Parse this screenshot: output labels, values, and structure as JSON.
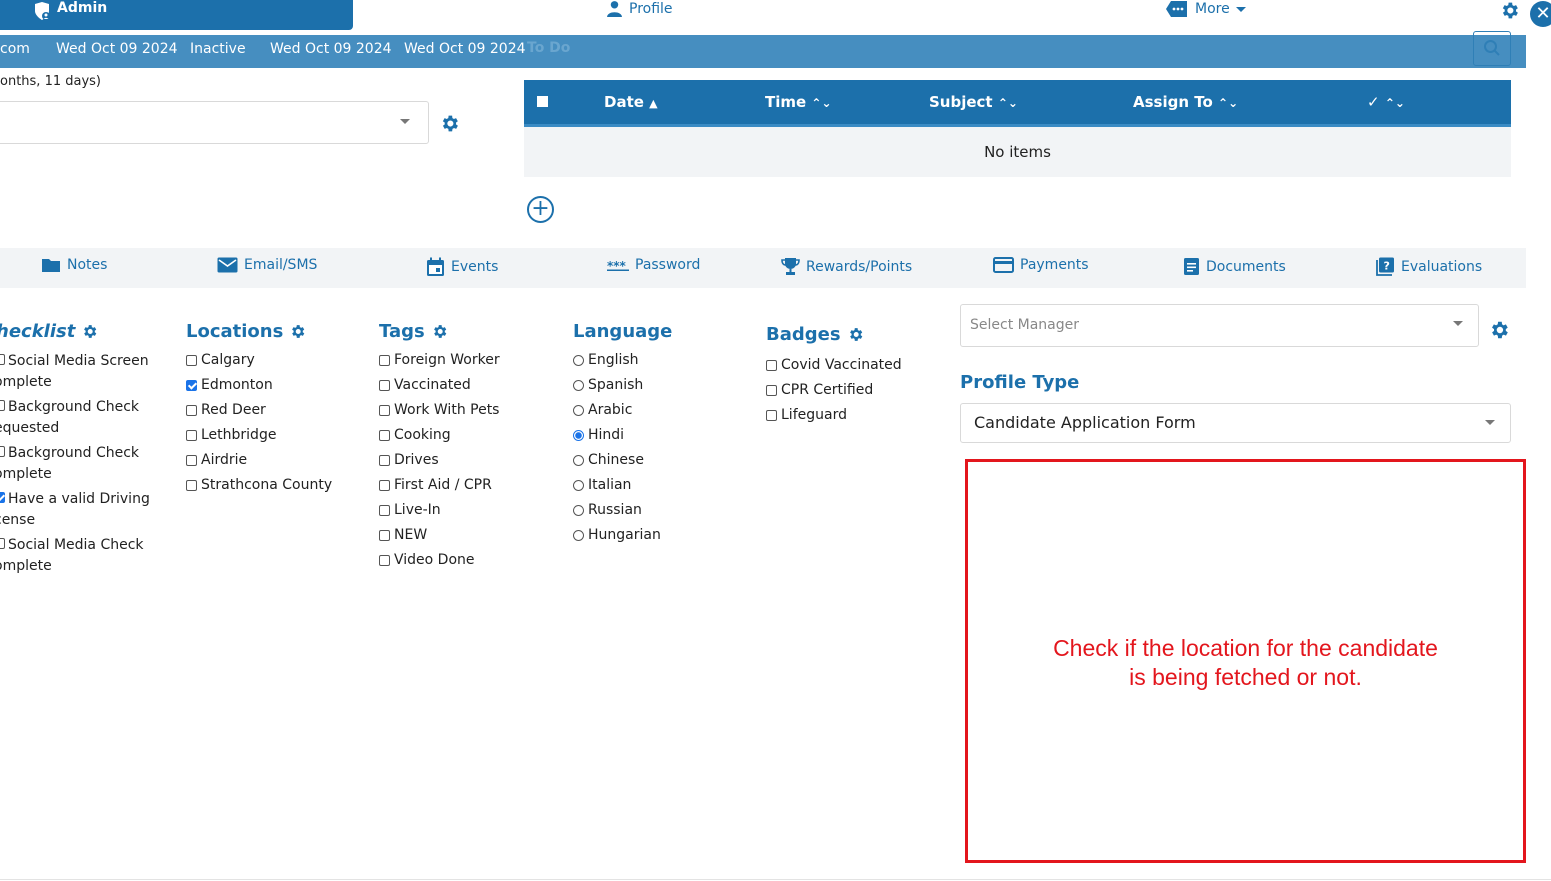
{
  "topbar": {
    "admin_label": "Admin",
    "profile_label": "Profile",
    "more_label": "More",
    "close_glyph": "✕"
  },
  "info_strip": {
    "email_tail": "com",
    "date1": "Wed Oct 09 2024",
    "status": "Inactive",
    "date2": "Wed Oct 09 2024",
    "date3": "Wed Oct 09 2024",
    "todo_title": "To Do"
  },
  "left_form": {
    "duration_text": "onths, 11 days)"
  },
  "todo_table": {
    "columns": [
      "Date",
      "Time",
      "Subject",
      "Assign To",
      "✓"
    ],
    "empty_text": "No items",
    "add_glyph": "+"
  },
  "tabs": [
    {
      "label": "Notes",
      "icon": "folder-icon"
    },
    {
      "label": "Email/SMS",
      "icon": "envelope-icon"
    },
    {
      "label": "Events",
      "icon": "calendar-icon"
    },
    {
      "label": "Password",
      "icon": "password-icon"
    },
    {
      "label": "Rewards/Points",
      "icon": "trophy-icon"
    },
    {
      "label": "Payments",
      "icon": "credit-card-icon"
    },
    {
      "label": "Documents",
      "icon": "document-icon"
    },
    {
      "label": "Evaluations",
      "icon": "evaluation-icon"
    }
  ],
  "checklist": {
    "title": "hecklist",
    "items": [
      {
        "line1": "Social Media Screen",
        "line2": "omplete",
        "checked": false
      },
      {
        "line1": "Background Check",
        "line2": "equested",
        "checked": false
      },
      {
        "line1": "Background Check",
        "line2": "omplete",
        "checked": false
      },
      {
        "line1": "Have a valid Driving",
        "line2": "cense",
        "checked": true
      },
      {
        "line1": "Social Media Check",
        "line2": "omplete",
        "checked": false
      }
    ]
  },
  "locations": {
    "title": "Locations",
    "items": [
      {
        "label": "Calgary",
        "checked": false
      },
      {
        "label": "Edmonton",
        "checked": true
      },
      {
        "label": "Red Deer",
        "checked": false
      },
      {
        "label": "Lethbridge",
        "checked": false
      },
      {
        "label": "Airdrie",
        "checked": false
      },
      {
        "label": "Strathcona County",
        "checked": false
      }
    ]
  },
  "tags": {
    "title": "Tags",
    "items": [
      {
        "label": "Foreign Worker",
        "checked": false
      },
      {
        "label": "Vaccinated",
        "checked": false
      },
      {
        "label": "Work With Pets",
        "checked": false
      },
      {
        "label": "Cooking",
        "checked": false
      },
      {
        "label": "Drives",
        "checked": false
      },
      {
        "label": "First Aid / CPR",
        "checked": false
      },
      {
        "label": "Live-In",
        "checked": false
      },
      {
        "label": "NEW",
        "checked": false
      },
      {
        "label": "Video Done",
        "checked": false
      }
    ]
  },
  "language": {
    "title": "Language",
    "items": [
      {
        "label": "English",
        "selected": false
      },
      {
        "label": "Spanish",
        "selected": false
      },
      {
        "label": "Arabic",
        "selected": false
      },
      {
        "label": "Hindi",
        "selected": true
      },
      {
        "label": "Chinese",
        "selected": false
      },
      {
        "label": "Italian",
        "selected": false
      },
      {
        "label": "Russian",
        "selected": false
      },
      {
        "label": "Hungarian",
        "selected": false
      }
    ]
  },
  "badges": {
    "title": "Badges",
    "items": [
      {
        "label": "Covid Vaccinated",
        "checked": false
      },
      {
        "label": "CPR Certified",
        "checked": false
      },
      {
        "label": "Lifeguard",
        "checked": false
      }
    ]
  },
  "manager": {
    "placeholder": "Select Manager"
  },
  "profile_type": {
    "title": "Profile Type",
    "value": "Candidate Application Form"
  },
  "annotation": {
    "line1": "Check if the location for the candidate",
    "line2": "is being fetched or not.",
    "color": "#e3161d"
  },
  "colors": {
    "brand": "#1c70ab",
    "strip": "#468ec0",
    "checkbox_on": "#1a73e8"
  }
}
